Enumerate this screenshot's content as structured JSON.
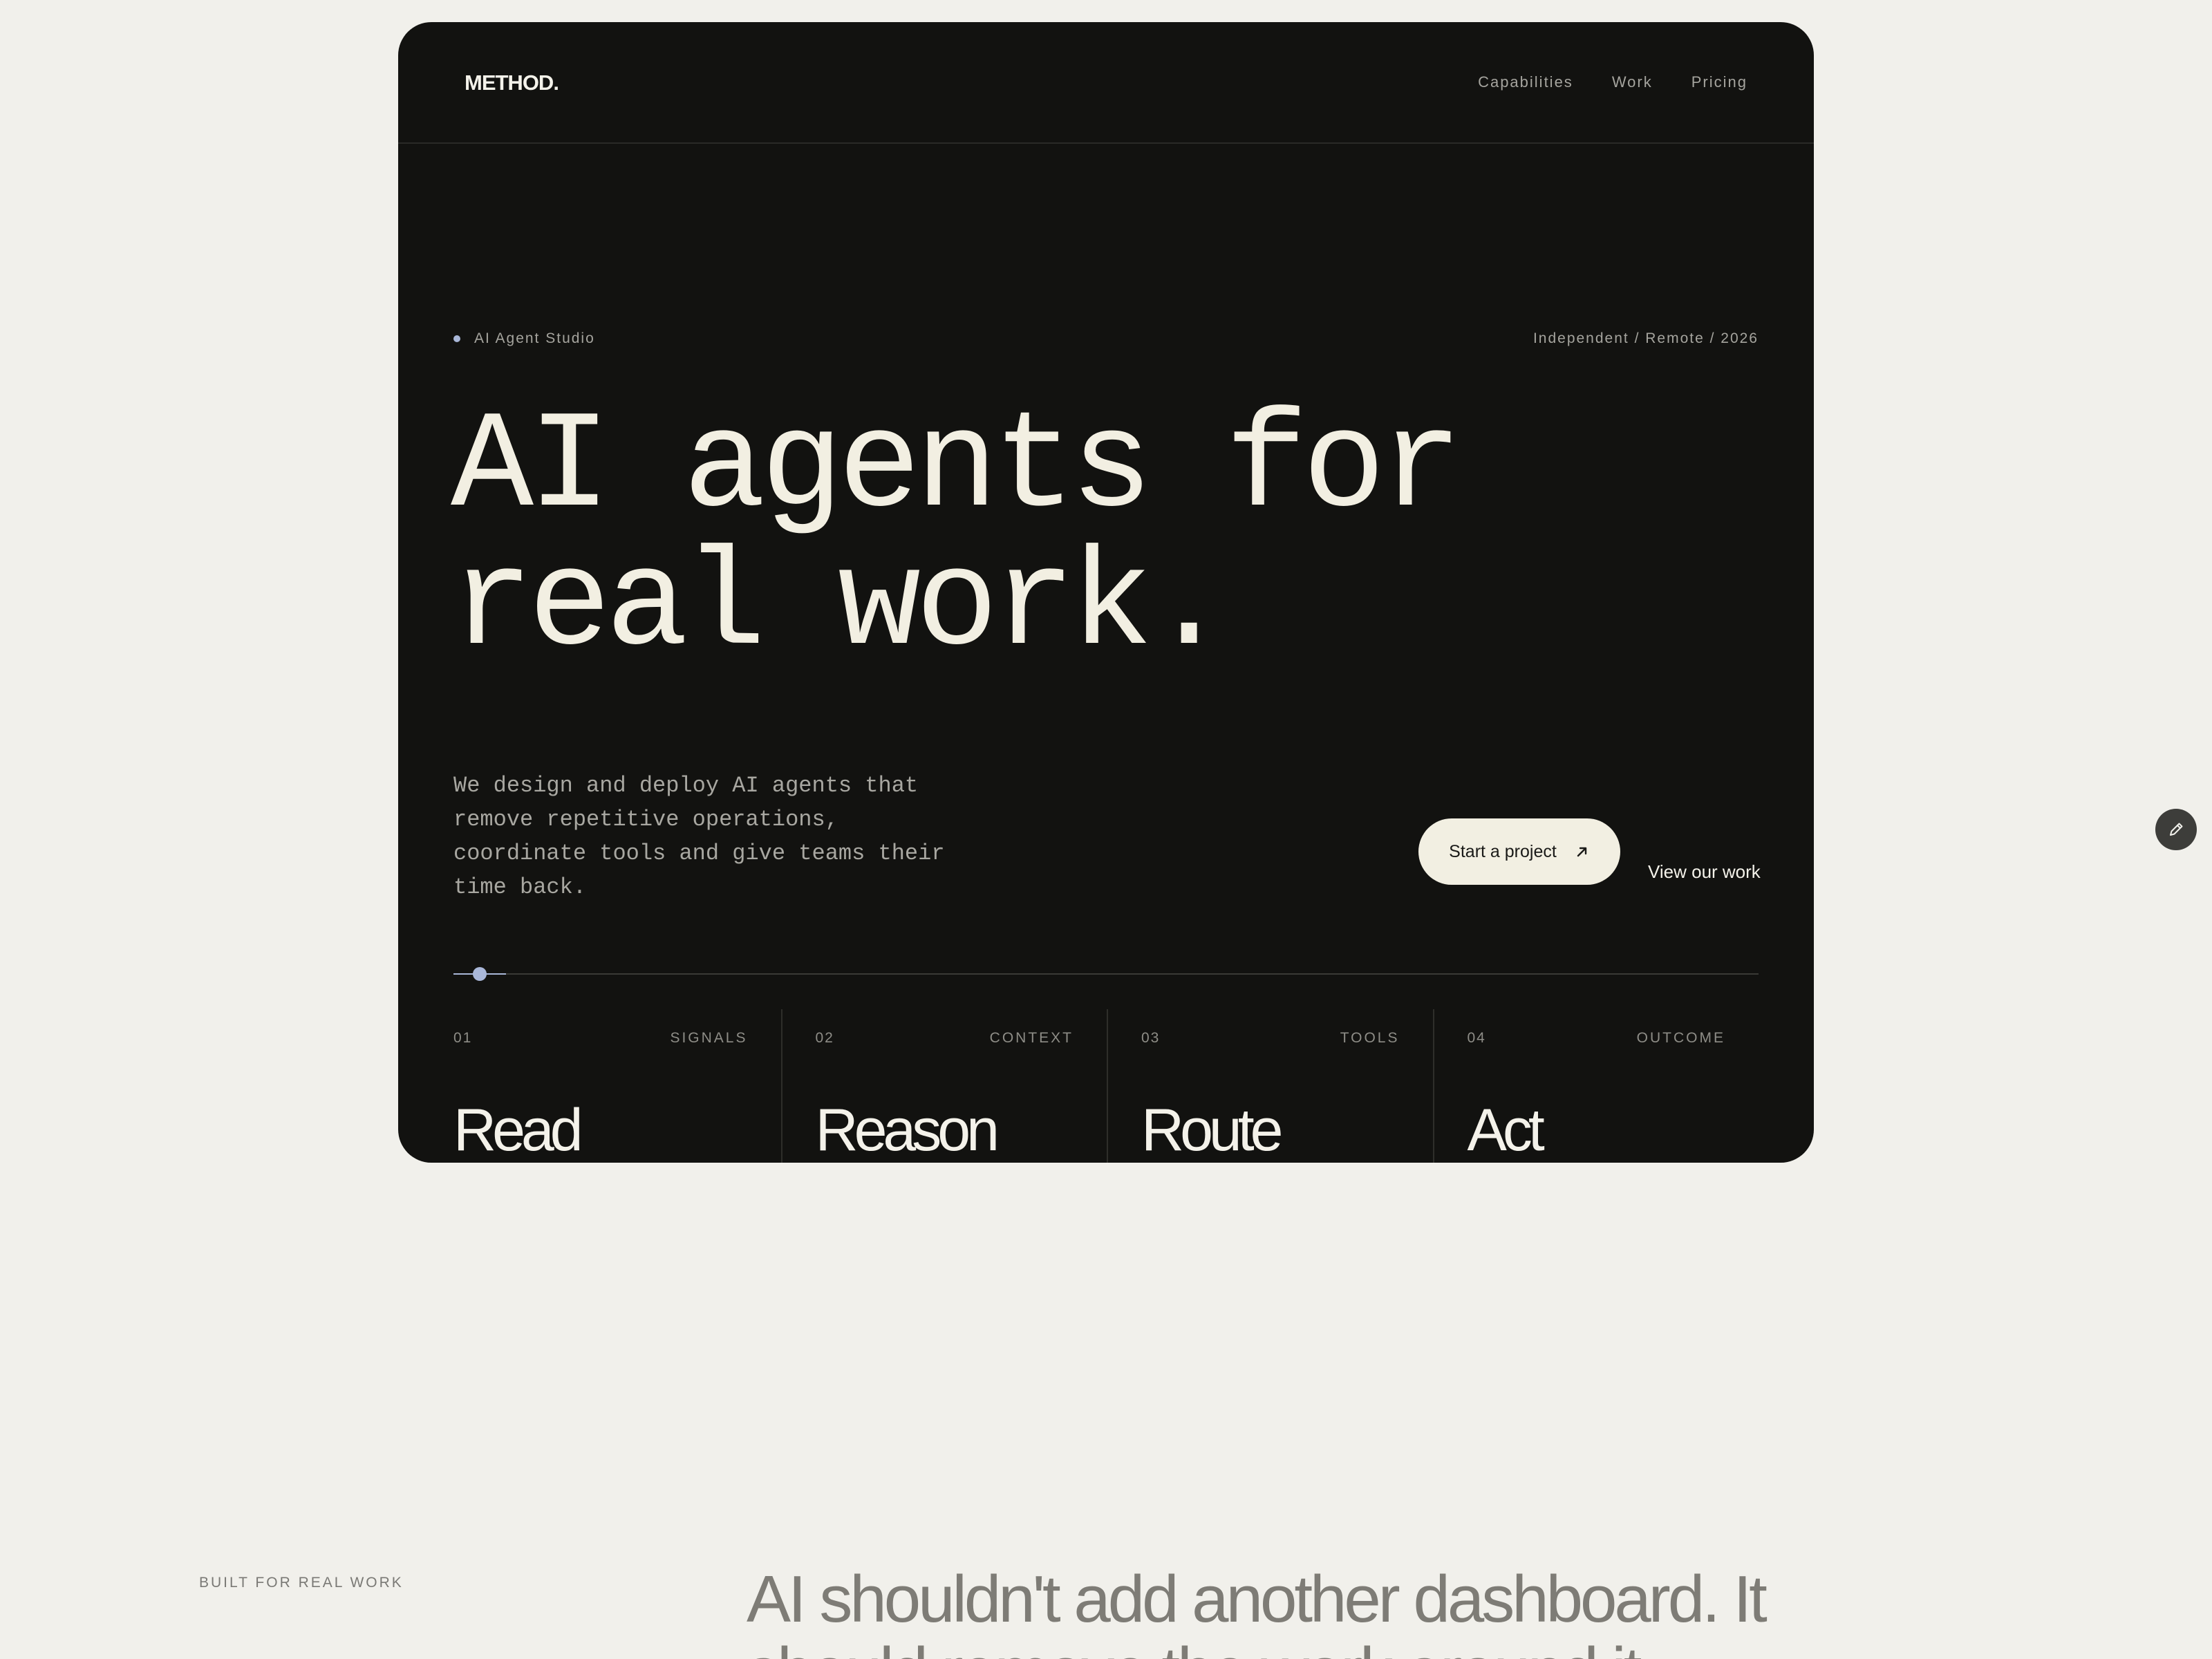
{
  "brand": {
    "logo": "METHOD."
  },
  "nav": {
    "links": [
      "Capabilities",
      "Work",
      "Pricing"
    ]
  },
  "hero": {
    "eyebrow": "AI Agent Studio",
    "meta": "Independent / Remote / 2026",
    "headline": [
      "AI agents for",
      "real work."
    ],
    "description": "We design and deploy AI agents that remove repetitive operations, coordinate tools and give teams their time back.",
    "primary_cta": "Start a project",
    "secondary_cta": "View our work",
    "accent_color": "#a9b7d8"
  },
  "steps": [
    {
      "number": "01",
      "tag": "SIGNALS",
      "title": "Read"
    },
    {
      "number": "02",
      "tag": "CONTEXT",
      "title": "Reason"
    },
    {
      "number": "03",
      "tag": "TOOLS",
      "title": "Route"
    },
    {
      "number": "04",
      "tag": "OUTCOME",
      "title": "Act"
    }
  ],
  "section": {
    "label": "BUILT FOR REAL WORK",
    "statement": "AI shouldn't add another dashboard. It should remove the work around it."
  },
  "icons": {
    "cta_arrow": "arrow-up-right-icon",
    "edit": "pencil-icon"
  }
}
